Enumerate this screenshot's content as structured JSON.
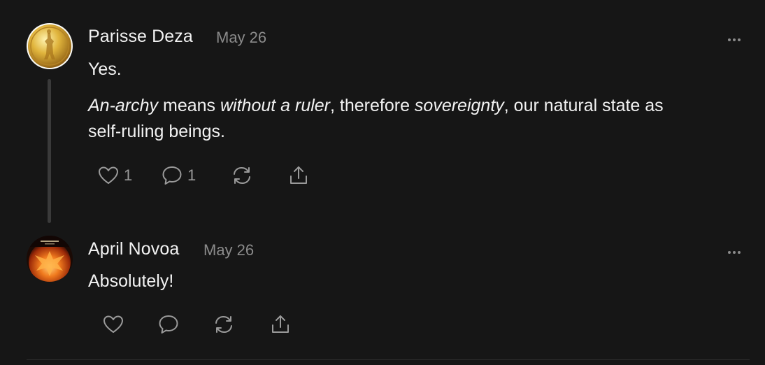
{
  "comments": [
    {
      "author": "Parisse Deza",
      "date": "May 26",
      "paragraph1": "Yes.",
      "p2": {
        "part1": "An-archy",
        "part2": " means ",
        "part3": "without a ruler",
        "part4": ", therefore ",
        "part5": "sovereignty",
        "part6": ", our natural state as",
        "line2": "self-ruling beings."
      },
      "like_count": "1",
      "reply_count": "1",
      "avatar_icon": "gold-coin-avatar",
      "more_icon": "more-horizontal-icon"
    },
    {
      "author": "April Novoa",
      "date": "May 26",
      "paragraph1": "Absolutely!",
      "avatar_icon": "phoenix-avatar",
      "more_icon": "more-horizontal-icon"
    }
  ],
  "colors": {
    "background": "#161616",
    "text": "#f2f2f2",
    "muted": "#8b8b8b",
    "thread_line": "#3a3a3a"
  }
}
